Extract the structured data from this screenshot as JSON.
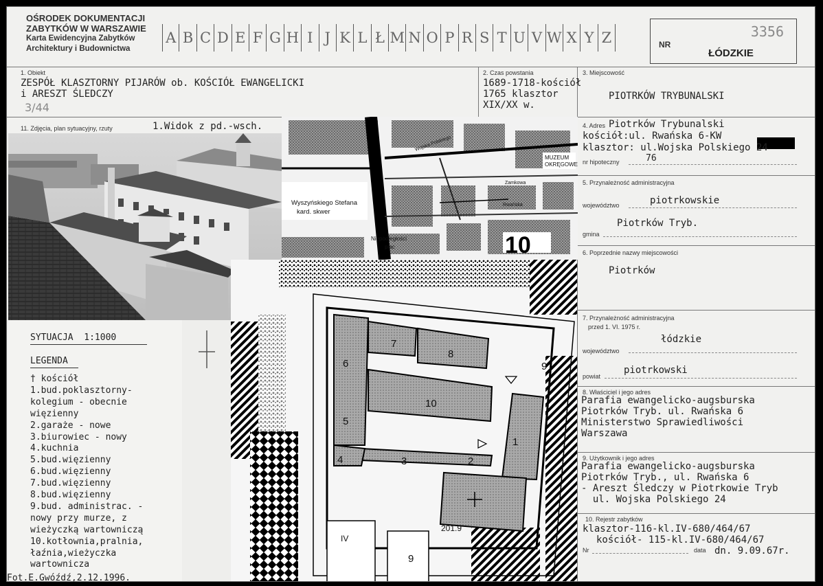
{
  "header": {
    "institution": [
      "OŚRODEK DOKUMENTACJI",
      "ZABYTKÓW W WARSZAWIE",
      "Karta Ewidencyjna Zabytków",
      "Architektury i Budownictwa"
    ],
    "alphabet": [
      "A",
      "B",
      "C",
      "D",
      "E",
      "F",
      "G",
      "H",
      "I",
      "J",
      "K",
      "L",
      "Ł",
      "M",
      "N",
      "O",
      "P",
      "R",
      "S",
      "T",
      "U",
      "V",
      "W",
      "X",
      "Y",
      "Z"
    ],
    "nr_label": "NR",
    "nr_number": "3356",
    "voivodeship": "ŁÓDZKIE"
  },
  "fields": {
    "f1": {
      "label": "1. Obiekt",
      "lines": [
        "ZESPÓŁ KLASZTORNY PIJARÓW ob. KOŚCIÓŁ EWANGELICKI",
        "i ARESZT ŚLEDCZY"
      ],
      "pencil": "3/44"
    },
    "f2": {
      "label": "2. Czas powstania",
      "lines": [
        "1689-1718-kościół",
        "1765 klasztor",
        "XIX/XX w."
      ]
    },
    "f3": {
      "label": "3. Miejscowość",
      "value": "PIOTRKÓW TRYBUNALSKI"
    },
    "f4": {
      "label": "4. Adres",
      "lines": [
        "Piotrków Trybunalski",
        "kościół:ul. Rwańska 6-KW",
        "klasztor: ul.Wojska Polskiego 24"
      ],
      "hipo_label": "nr hipoteczny",
      "hipo_value": "76"
    },
    "f5": {
      "label": "5. Przynależność administracyjna",
      "woj_label": "województwo",
      "woj_value": "piotrkowskie",
      "gmina_label": "gmina",
      "gmina_value": "Piotrków Tryb."
    },
    "f6": {
      "label": "6. Poprzednie nazwy miejscowości",
      "value": "Piotrków"
    },
    "f7": {
      "label": "7. Przynależność administracyjna",
      "sub": "przed 1. VI. 1975 r.",
      "woj_label": "województwo",
      "woj_value": "łódzkie",
      "powiat_label": "powiat",
      "powiat_value": "piotrkowski"
    },
    "f8": {
      "label": "8. Właściciel i jego adres",
      "lines": [
        "Parafia ewangelicko-augsburska",
        "Piotrków Tryb. ul. Rwańska 6",
        "Ministerstwo Sprawiedliwości",
        "Warszawa"
      ]
    },
    "f9": {
      "label": "9. Użytkownik i jego adres",
      "lines": [
        "Parafia ewangelicko-augsburska",
        "Piotrków Tryb., ul. Rwańska 6",
        "- Areszt Śledczy w Piotrkowie Tryb",
        "  ul. Wojska Polskiego 24"
      ]
    },
    "f10": {
      "label": "10. Rejestr zabytków",
      "nr_label": "Nr",
      "data_label": "data",
      "lines": [
        "klasztor-116-kl.IV-680/464/67",
        "kościół- 115-kl.IV-680/464/67",
        "dn. 9.09.67r."
      ]
    },
    "f11": {
      "label": "11. Zdjęcia, plan sytuacyjny, rzuty",
      "value": "1.Widok z pd.-wsch."
    }
  },
  "map": {
    "labels": [
      "Wyszyńskiego Stefana",
      "kard. skwer",
      "Niepodległości",
      "plac",
      "MUZEUM",
      "OKRĘGOWE",
      "Wojska Polskiego",
      "Zamkowa",
      "Rwańska",
      "10"
    ]
  },
  "site_plan": {
    "numbers": [
      "1",
      "2",
      "3",
      "4",
      "5",
      "6",
      "7",
      "8",
      "9",
      "10",
      "IV",
      "9"
    ],
    "elevation": "201.9"
  },
  "legend": {
    "title": "SYTUACJA  1:1000",
    "subtitle": "LEGENDA",
    "items": [
      "† kościół",
      "1.bud.poklasztorny-",
      "kolegium - obecnie",
      "więzienny",
      "2.garaże - nowe",
      "3.biurowiec - nowy",
      "4.kuchnia",
      "5.bud.więzienny",
      "6.bud.więzienny",
      "7.bud.więzienny",
      "8.bud.więzienny",
      "9.bud. administrac. -",
      "nowy przy murze, z",
      "wieżyczką wartowniczą",
      "10.kotłownia,pralnia,",
      "łaźnia,wieżyczka",
      "wartownicza"
    ],
    "photo_credit": "Fot.E.Gwóźdź,2.12.1996."
  }
}
